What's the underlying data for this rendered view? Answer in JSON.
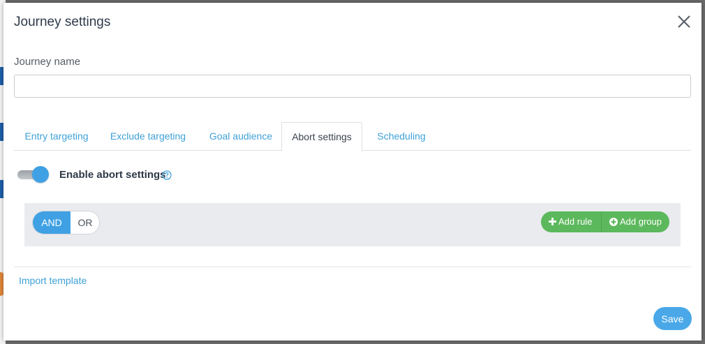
{
  "modal": {
    "title": "Journey settings"
  },
  "form": {
    "journey_name_label": "Journey name",
    "journey_name_value": "",
    "journey_name_placeholder": ""
  },
  "tabs": [
    {
      "label": "Entry targeting",
      "active": false
    },
    {
      "label": "Exclude targeting",
      "active": false
    },
    {
      "label": "Goal audience",
      "active": false
    },
    {
      "label": "Abort settings",
      "active": true
    },
    {
      "label": "Scheduling",
      "active": false
    }
  ],
  "abort_settings": {
    "toggle_label": "Enable abort settings",
    "enabled": true,
    "logic": {
      "and_label": "AND",
      "or_label": "OR",
      "selected": "AND"
    },
    "add_rule_label": "Add rule",
    "add_group_label": "Add group"
  },
  "footer": {
    "import_template_label": "Import template",
    "save_label": "Save"
  },
  "colors": {
    "accent_blue": "#3fa1e4",
    "link_blue": "#3fa1d8",
    "action_green": "#5cb85c"
  },
  "icons": {
    "close": "close-icon",
    "help": "question-circle-icon",
    "add_rule": "plus-icon",
    "add_group": "plus-circle-icon"
  }
}
